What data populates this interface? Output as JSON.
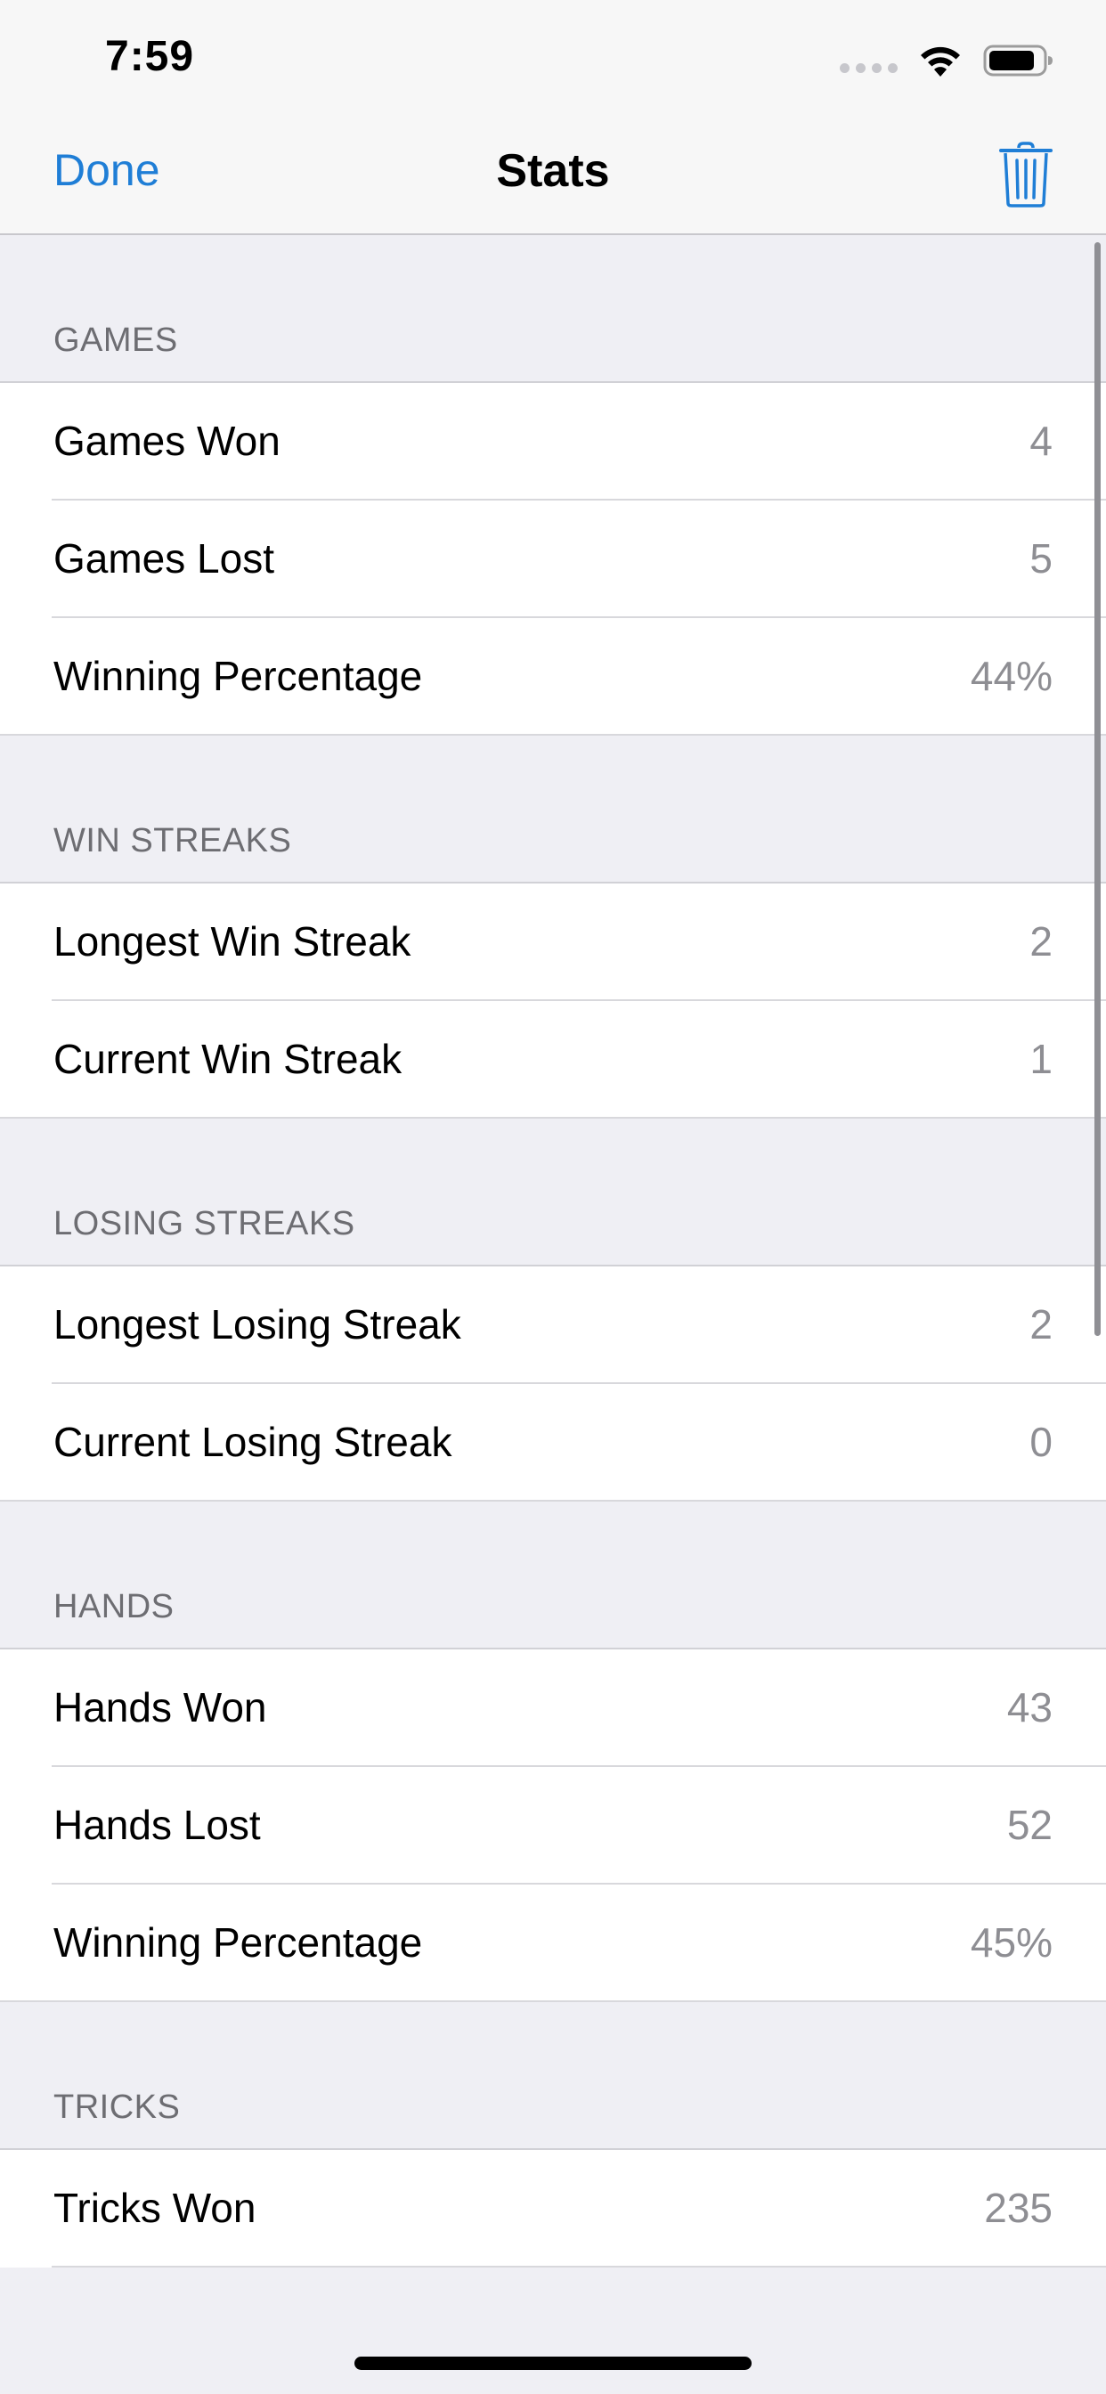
{
  "status_bar": {
    "time": "7:59"
  },
  "nav": {
    "done_label": "Done",
    "title": "Stats",
    "trash_icon": "trash-icon"
  },
  "sections": [
    {
      "header": "GAMES",
      "rows": [
        {
          "title": "Games Won",
          "value": "4"
        },
        {
          "title": "Games Lost",
          "value": "5"
        },
        {
          "title": "Winning Percentage",
          "value": "44%"
        }
      ]
    },
    {
      "header": "WIN STREAKS",
      "rows": [
        {
          "title": "Longest Win Streak",
          "value": "2"
        },
        {
          "title": "Current Win Streak",
          "value": "1"
        }
      ]
    },
    {
      "header": "LOSING STREAKS",
      "rows": [
        {
          "title": "Longest Losing Streak",
          "value": "2"
        },
        {
          "title": "Current Losing Streak",
          "value": "0"
        }
      ]
    },
    {
      "header": "HANDS",
      "rows": [
        {
          "title": "Hands Won",
          "value": "43"
        },
        {
          "title": "Hands Lost",
          "value": "52"
        },
        {
          "title": "Winning Percentage",
          "value": "45%"
        }
      ]
    },
    {
      "header": "TRICKS",
      "rows": [
        {
          "title": "Tricks Won",
          "value": "235"
        }
      ]
    }
  ],
  "colors": {
    "accent": "#1f7ed6",
    "background": "#efeff4",
    "value_text": "#8e8e93",
    "header_text": "#6d6d72"
  }
}
